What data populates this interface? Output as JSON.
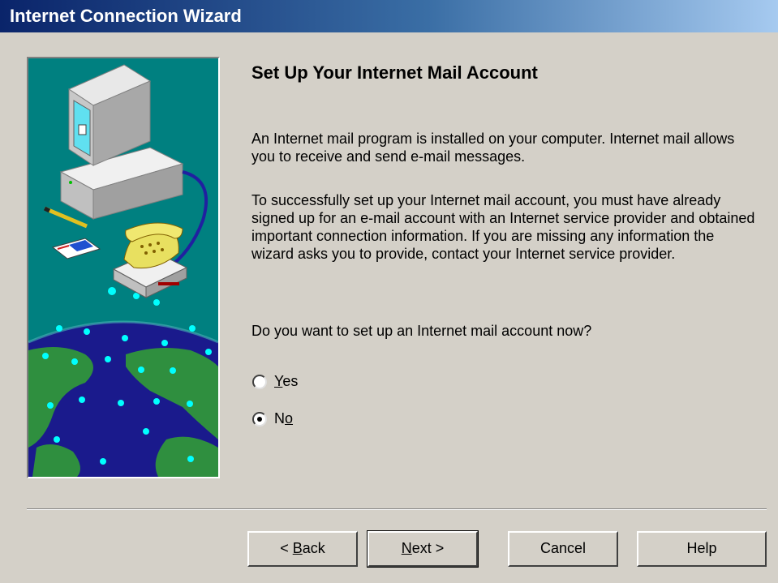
{
  "window": {
    "title": "Internet Connection Wizard"
  },
  "page": {
    "heading": "Set Up Your Internet Mail Account",
    "paragraph1": "An Internet mail program is installed on your computer. Internet mail allows you to receive and send e-mail messages.",
    "paragraph2": "To successfully set up your Internet mail account, you must have already signed up for an e-mail account with an Internet service provider and obtained important connection information. If you are missing any information the wizard asks you to provide, contact your Internet service provider.",
    "question": "Do you want to set up an Internet mail account now?"
  },
  "options": {
    "yes": {
      "mnemonic": "Y",
      "rest": "es",
      "selected": false
    },
    "no": {
      "prefix": "N",
      "mnemonic": "o",
      "selected": true
    }
  },
  "buttons": {
    "back": {
      "prefix": "< ",
      "mnemonic": "B",
      "rest": "ack"
    },
    "next": {
      "mnemonic": "N",
      "rest": "ext >"
    },
    "cancel": "Cancel",
    "help": "Help"
  },
  "colors": {
    "titlebar_start": "#0a246a",
    "titlebar_end": "#a6caf0",
    "dialog_face": "#d4d0c8",
    "illustration_bg": "#008080"
  }
}
